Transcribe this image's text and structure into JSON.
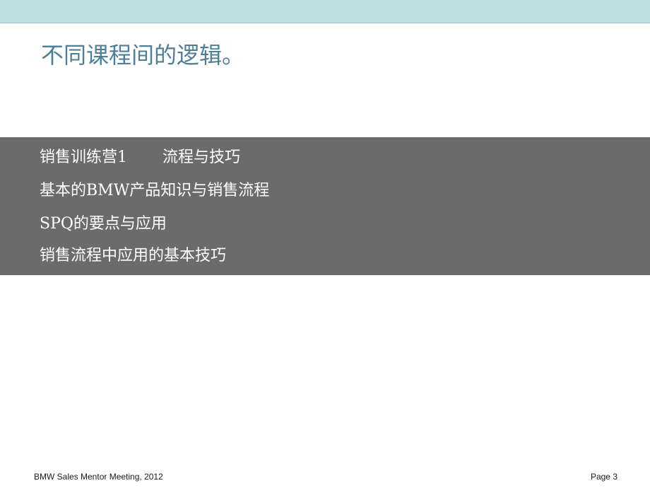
{
  "slide": {
    "title": "不同课程间的逻辑。"
  },
  "content": {
    "line1_left": "销售训练营1",
    "line1_right": "流程与技巧",
    "line2": "基本的BMW产品知识与销售流程",
    "line3": "SPQ的要点与应用",
    "line4": "销售流程中应用的基本技巧"
  },
  "footer": {
    "left": "BMW Sales Mentor Meeting, 2012",
    "right": "Page 3"
  },
  "colors": {
    "top_band": "#bcdfe2",
    "title": "#4f7f96",
    "content_band": "#6b6b6b",
    "content_text": "#ffffff"
  }
}
